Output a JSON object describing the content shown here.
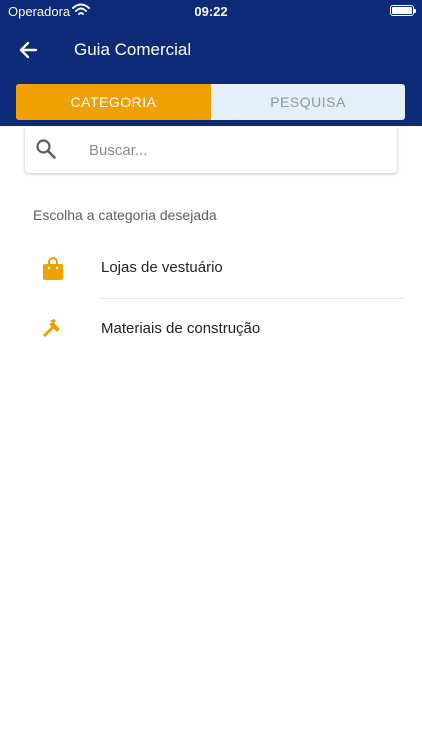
{
  "status_bar": {
    "carrier": "Operadora",
    "time": "09:22"
  },
  "header": {
    "title": "Guia Comercial"
  },
  "tabs": [
    {
      "label": "CATEGORIA",
      "active": true
    },
    {
      "label": "PESQUISA",
      "active": false
    }
  ],
  "search": {
    "placeholder": "Buscar...",
    "value": ""
  },
  "section_label": "Escolha a categoria desejada",
  "categories": [
    {
      "label": "Lojas de vestuário",
      "icon": "shopping-bag-icon"
    },
    {
      "label": "Materiais de construção",
      "icon": "hammer-icon"
    }
  ],
  "colors": {
    "header": "#0d2a78",
    "accent": "#f0a000",
    "tab_inactive": "#e5effa",
    "icon": "#f0a000"
  }
}
